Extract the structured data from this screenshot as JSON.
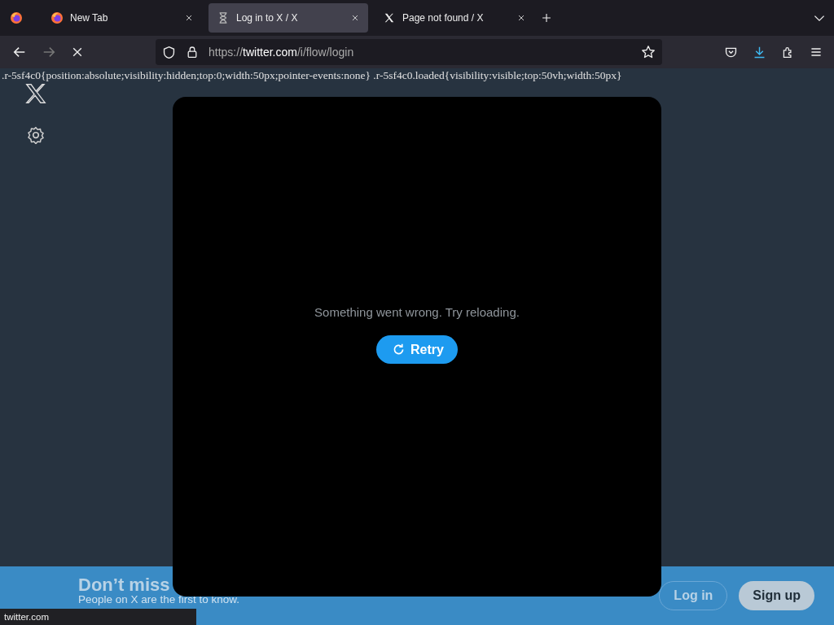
{
  "tabs": [
    {
      "label": "New Tab",
      "kind": "firefox",
      "selected": false
    },
    {
      "label": "Log in to X / X",
      "kind": "loading",
      "selected": true
    },
    {
      "label": "Page not found / X",
      "kind": "x",
      "selected": false
    }
  ],
  "address": {
    "scheme": "https://",
    "domain": "twitter.com",
    "path": "/i/flow/login"
  },
  "page": {
    "css_text": ".r-5sf4c0{position:absolute;visibility:hidden;top:0;width:50px;pointer-events:none} .r-5sf4c0.loaded{visibility:visible;top:50vh;width:50px}",
    "modal": {
      "message": "Something went wrong. Try reloading.",
      "button": "Retry"
    },
    "banner": {
      "title": "Don’t miss",
      "subtitle": "People on X are the first to know.",
      "login": "Log in",
      "signup": "Sign up"
    }
  },
  "status_bar": "twitter.com"
}
